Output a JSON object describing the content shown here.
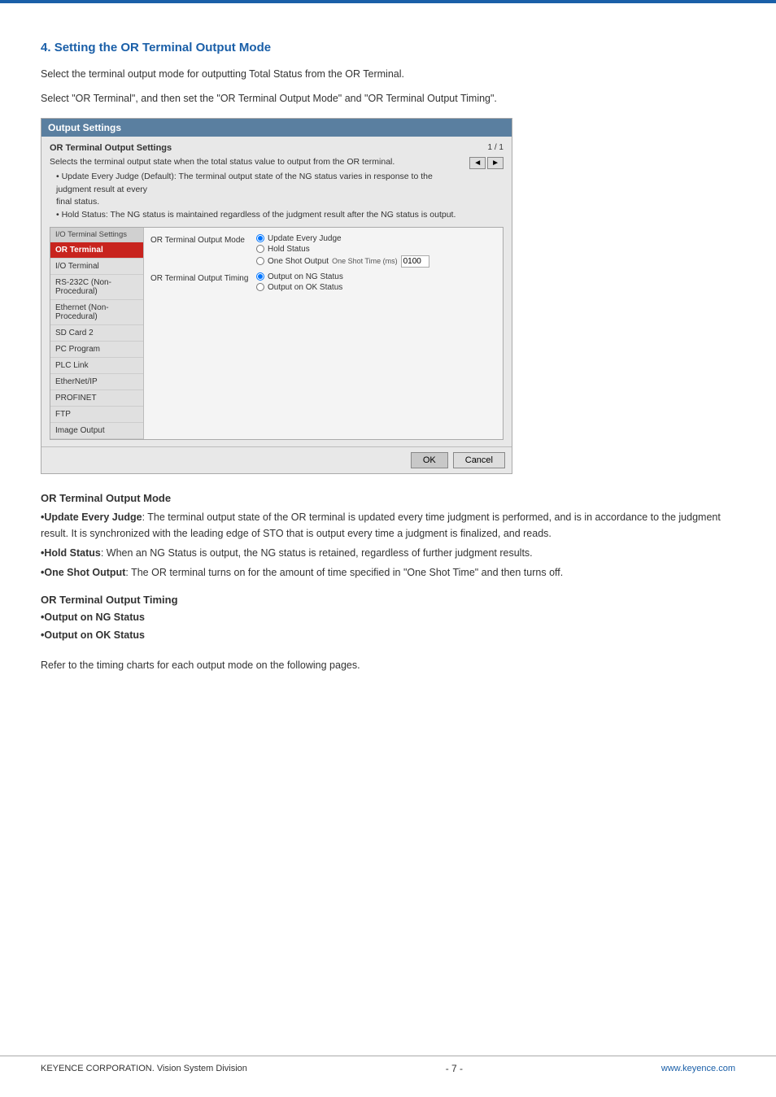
{
  "page": {
    "top_bar_color": "#1a5fa8",
    "section_number": "4.",
    "section_title": "Setting the OR Terminal Output Mode",
    "intro1": "Select the terminal output mode for outputting Total Status from the OR Terminal.",
    "intro2": "Select \"OR Terminal\", and then set the \"OR Terminal Output Mode\" and \"OR Terminal Output Timing\".",
    "dialog": {
      "title": "Output Settings",
      "subtitle": "OR Terminal Output Settings",
      "desc_line1": "Selects the terminal output state when the total status value to output from the OR terminal.",
      "desc_bullet1": "• Update Every Judge (Default): The terminal output state of the NG status varies in response to the judgment result at every",
      "desc_bullet1b": "final status.",
      "desc_bullet2": "• Hold Status: The NG status is maintained regardless of the judgment result after the NG status is output.",
      "page_counter": "1 / 1",
      "nav_prev": "◄",
      "nav_next": "►",
      "sidebar_header": "I/O Terminal Settings",
      "sidebar_items": [
        {
          "label": "OR Terminal",
          "active": true
        },
        {
          "label": "I/O Terminal",
          "active": false
        },
        {
          "label": "RS-232C (Non-Procedural)",
          "active": false
        },
        {
          "label": "Ethernet (Non-Procedural)",
          "active": false
        },
        {
          "label": "SD Card 2",
          "active": false
        },
        {
          "label": "PC Program",
          "active": false
        },
        {
          "label": "PLC Link",
          "active": false
        },
        {
          "label": "EtherNet/IP",
          "active": false
        },
        {
          "label": "PROFINET",
          "active": false
        },
        {
          "label": "FTP",
          "active": false
        },
        {
          "label": "Image Output",
          "active": false
        }
      ],
      "mode_label": "OR Terminal Output Mode",
      "mode_options": [
        {
          "label": "Update Every Judge",
          "selected": true
        },
        {
          "label": "Hold Status",
          "selected": false
        },
        {
          "label": "One Shot Output",
          "selected": false
        }
      ],
      "one_shot_label": "One Shot Time (ms)",
      "one_shot_value": "0100",
      "timing_label": "OR Terminal Output Timing",
      "timing_options": [
        {
          "label": "Output on NG Status",
          "selected": true
        },
        {
          "label": "Output on OK Status",
          "selected": false
        }
      ],
      "ok_button": "OK",
      "cancel_button": "Cancel"
    },
    "mode_section": {
      "title": "OR Terminal Output Mode",
      "bullets": [
        {
          "bold_text": "Update Every Judge",
          "rest": ": The terminal output state of the OR terminal is updated every time judgment is performed, and is in accordance to the judgment result. It is synchronized with the leading edge of STO that is output every time a judgment is finalized, and reads."
        },
        {
          "bold_text": "Hold Status",
          "rest": ": When an NG Status is output, the NG status is retained, regardless of further judgment results."
        },
        {
          "bold_text": "One Shot Output",
          "rest": ": The OR terminal turns on for the amount of time specified in \"One Shot Time\" and then turns off."
        }
      ]
    },
    "timing_section": {
      "title": "OR Terminal Output Timing",
      "items": [
        "•Output on NG Status",
        "•Output on OK Status"
      ]
    },
    "refer_text": "Refer to the timing charts for each output mode on the following pages.",
    "footer": {
      "left": "KEYENCE CORPORATION. Vision System Division",
      "center": "- 7 -",
      "right": "www.keyence.com"
    }
  }
}
